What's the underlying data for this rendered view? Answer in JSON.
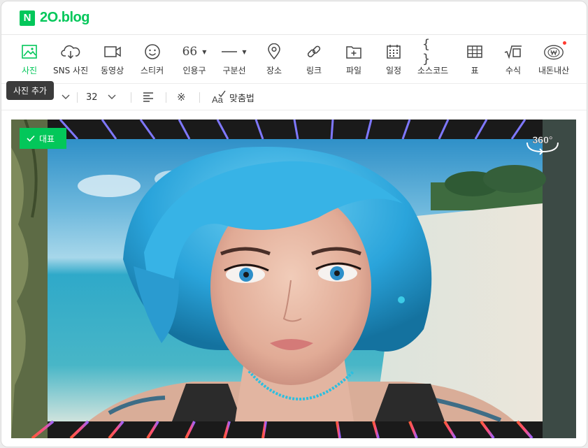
{
  "app": {
    "logo_letter": "N",
    "logo_text": "2O.blog",
    "brand_color": "#03c75a"
  },
  "toolbar": {
    "items": [
      {
        "label": "사진",
        "icon": "photo-icon",
        "active": true
      },
      {
        "label": "SNS 사진",
        "icon": "cloud-download-icon"
      },
      {
        "label": "동영상",
        "icon": "video-icon"
      },
      {
        "label": "스티커",
        "icon": "smiley-icon"
      },
      {
        "label": "인용구",
        "icon": "quote-icon",
        "glyph": "66"
      },
      {
        "label": "구분선",
        "icon": "divider-line-icon"
      },
      {
        "label": "장소",
        "icon": "map-pin-icon"
      },
      {
        "label": "링크",
        "icon": "link-icon"
      },
      {
        "label": "파일",
        "icon": "folder-plus-icon"
      },
      {
        "label": "일정",
        "icon": "calendar-icon"
      },
      {
        "label": "소스코드",
        "icon": "code-braces-icon",
        "glyph": "{ }"
      },
      {
        "label": "표",
        "icon": "table-icon"
      },
      {
        "label": "수식",
        "icon": "math-sqrt-icon"
      },
      {
        "label": "내돈내산",
        "icon": "won-badge-icon",
        "notification": true
      }
    ]
  },
  "tooltip": {
    "text": "사진 추가"
  },
  "format_bar": {
    "font_size": "32",
    "spellcheck_label": "맞춤법"
  },
  "editor": {
    "representative_badge": "대표",
    "badge_360": "360°"
  }
}
